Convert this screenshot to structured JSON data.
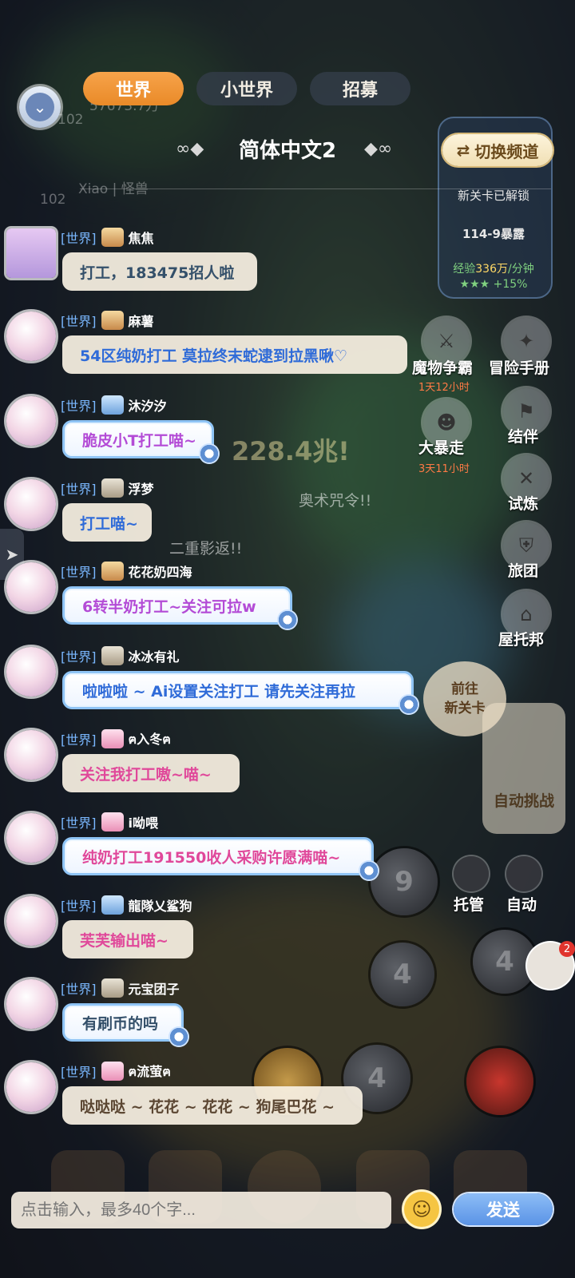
{
  "tabs": [
    {
      "label": "世界",
      "active": true
    },
    {
      "label": "小世界",
      "active": false
    },
    {
      "label": "招募",
      "active": false
    }
  ],
  "channel": {
    "title": "简体中文2",
    "switch_label": "切换频道"
  },
  "ghost": {
    "top_number": "57673.7万",
    "level_a": "102",
    "level_b": "102",
    "top_user": "Xiao | 怪兽",
    "unlock_text": "新关卡已解锁",
    "stage": "114-9暴露",
    "exp_label": "经验",
    "exp_value": "336万",
    "exp_unit": "/分钟",
    "exp_bonus": "+15%",
    "crit": "228.4兆!",
    "arcane": "奥术咒令!!",
    "double": "二重影返!!"
  },
  "messages": [
    {
      "channel": "[世界]",
      "user": "焦焦",
      "text": "打工，183475招人啦",
      "style": "plain",
      "color": "#34506a"
    },
    {
      "channel": "[世界]",
      "user": "麻薯",
      "text": "54区纯奶打工  莫拉终末蛇逮到拉黑啾♡",
      "style": "plain",
      "color": "#2f6bd8"
    },
    {
      "channel": "[世界]",
      "user": "沐汐汐",
      "text": "脆皮小T打工喵~",
      "style": "fancy",
      "color": "#b34bd6"
    },
    {
      "channel": "[世界]",
      "user": "浮梦",
      "text": "打工喵~",
      "style": "plain",
      "color": "#2f6bd8"
    },
    {
      "channel": "[世界]",
      "user": "花花奶四海",
      "text": "6转半奶打工~关注可拉w",
      "style": "fancy",
      "color": "#b34bd6"
    },
    {
      "channel": "[世界]",
      "user": "冰冰有礼",
      "text": "啦啦啦 ~  Ai设置关注打工  请先关注再拉",
      "style": "fancy",
      "color": "#2f6bd8"
    },
    {
      "channel": "[世界]",
      "user": "ฅ入冬ฅ",
      "text": "关注我打工嗷~喵~",
      "style": "plain",
      "color": "#e0489a"
    },
    {
      "channel": "[世界]",
      "user": "i呦喂",
      "text": "纯奶打工191550收人采购许愿满喵~",
      "style": "fancy",
      "color": "#e0489a"
    },
    {
      "channel": "[世界]",
      "user": "龍隊乂鲨狗",
      "text": "芙芙输出喵~",
      "style": "plain",
      "color": "#e0489a"
    },
    {
      "channel": "[世界]",
      "user": "元宝团子",
      "text": "有刷币的吗",
      "style": "fancy",
      "color": "#34506a"
    },
    {
      "channel": "[世界]",
      "user": "ฅ流萤ฅ",
      "text": "哒哒哒 ~ 花花 ~ 花花 ~ 狗尾巴花 ~",
      "style": "plain",
      "color": "#5b4632"
    }
  ],
  "right_menu": [
    {
      "label": "魔物争霸",
      "timer": "1天12小时"
    },
    {
      "label": "冒险手册",
      "timer": ""
    },
    {
      "label": "结伴",
      "timer": ""
    },
    {
      "label": "大暴走",
      "timer": "3天11小时"
    },
    {
      "label": "试炼",
      "timer": ""
    },
    {
      "label": "旅团",
      "timer": ""
    },
    {
      "label": "屋托邦",
      "timer": ""
    }
  ],
  "goto_label": "前往\n新关卡",
  "auto_challenge": "自动挑战",
  "controls": {
    "host": "托管",
    "auto": "自动"
  },
  "skills": [
    "9",
    "4",
    "4",
    "4"
  ],
  "pet_badge": "2",
  "input": {
    "placeholder": "点击输入，最多40个字..."
  },
  "send_label": "发送"
}
